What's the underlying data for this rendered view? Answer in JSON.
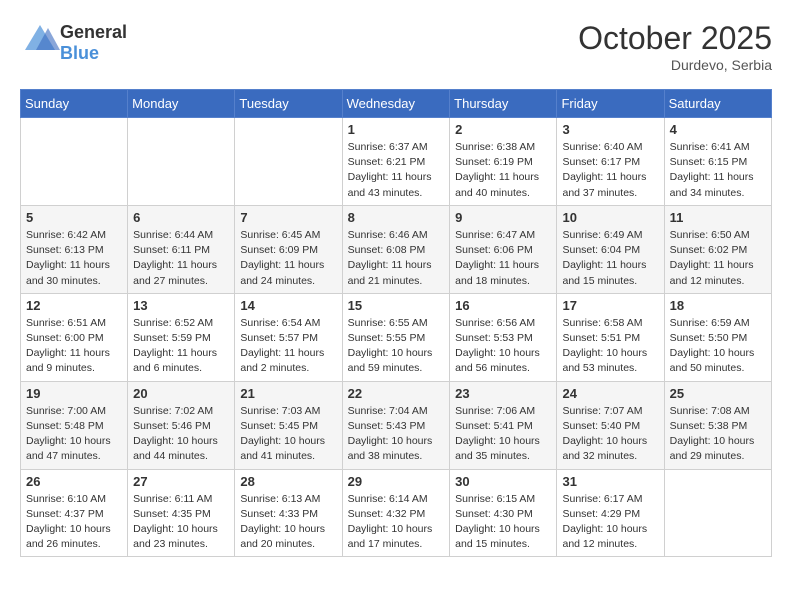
{
  "header": {
    "logo_general": "General",
    "logo_blue": "Blue",
    "month": "October 2025",
    "location": "Durdevo, Serbia"
  },
  "weekdays": [
    "Sunday",
    "Monday",
    "Tuesday",
    "Wednesday",
    "Thursday",
    "Friday",
    "Saturday"
  ],
  "weeks": [
    [
      {
        "day": "",
        "info": ""
      },
      {
        "day": "",
        "info": ""
      },
      {
        "day": "",
        "info": ""
      },
      {
        "day": "1",
        "info": "Sunrise: 6:37 AM\nSunset: 6:21 PM\nDaylight: 11 hours\nand 43 minutes."
      },
      {
        "day": "2",
        "info": "Sunrise: 6:38 AM\nSunset: 6:19 PM\nDaylight: 11 hours\nand 40 minutes."
      },
      {
        "day": "3",
        "info": "Sunrise: 6:40 AM\nSunset: 6:17 PM\nDaylight: 11 hours\nand 37 minutes."
      },
      {
        "day": "4",
        "info": "Sunrise: 6:41 AM\nSunset: 6:15 PM\nDaylight: 11 hours\nand 34 minutes."
      }
    ],
    [
      {
        "day": "5",
        "info": "Sunrise: 6:42 AM\nSunset: 6:13 PM\nDaylight: 11 hours\nand 30 minutes."
      },
      {
        "day": "6",
        "info": "Sunrise: 6:44 AM\nSunset: 6:11 PM\nDaylight: 11 hours\nand 27 minutes."
      },
      {
        "day": "7",
        "info": "Sunrise: 6:45 AM\nSunset: 6:09 PM\nDaylight: 11 hours\nand 24 minutes."
      },
      {
        "day": "8",
        "info": "Sunrise: 6:46 AM\nSunset: 6:08 PM\nDaylight: 11 hours\nand 21 minutes."
      },
      {
        "day": "9",
        "info": "Sunrise: 6:47 AM\nSunset: 6:06 PM\nDaylight: 11 hours\nand 18 minutes."
      },
      {
        "day": "10",
        "info": "Sunrise: 6:49 AM\nSunset: 6:04 PM\nDaylight: 11 hours\nand 15 minutes."
      },
      {
        "day": "11",
        "info": "Sunrise: 6:50 AM\nSunset: 6:02 PM\nDaylight: 11 hours\nand 12 minutes."
      }
    ],
    [
      {
        "day": "12",
        "info": "Sunrise: 6:51 AM\nSunset: 6:00 PM\nDaylight: 11 hours\nand 9 minutes."
      },
      {
        "day": "13",
        "info": "Sunrise: 6:52 AM\nSunset: 5:59 PM\nDaylight: 11 hours\nand 6 minutes."
      },
      {
        "day": "14",
        "info": "Sunrise: 6:54 AM\nSunset: 5:57 PM\nDaylight: 11 hours\nand 2 minutes."
      },
      {
        "day": "15",
        "info": "Sunrise: 6:55 AM\nSunset: 5:55 PM\nDaylight: 10 hours\nand 59 minutes."
      },
      {
        "day": "16",
        "info": "Sunrise: 6:56 AM\nSunset: 5:53 PM\nDaylight: 10 hours\nand 56 minutes."
      },
      {
        "day": "17",
        "info": "Sunrise: 6:58 AM\nSunset: 5:51 PM\nDaylight: 10 hours\nand 53 minutes."
      },
      {
        "day": "18",
        "info": "Sunrise: 6:59 AM\nSunset: 5:50 PM\nDaylight: 10 hours\nand 50 minutes."
      }
    ],
    [
      {
        "day": "19",
        "info": "Sunrise: 7:00 AM\nSunset: 5:48 PM\nDaylight: 10 hours\nand 47 minutes."
      },
      {
        "day": "20",
        "info": "Sunrise: 7:02 AM\nSunset: 5:46 PM\nDaylight: 10 hours\nand 44 minutes."
      },
      {
        "day": "21",
        "info": "Sunrise: 7:03 AM\nSunset: 5:45 PM\nDaylight: 10 hours\nand 41 minutes."
      },
      {
        "day": "22",
        "info": "Sunrise: 7:04 AM\nSunset: 5:43 PM\nDaylight: 10 hours\nand 38 minutes."
      },
      {
        "day": "23",
        "info": "Sunrise: 7:06 AM\nSunset: 5:41 PM\nDaylight: 10 hours\nand 35 minutes."
      },
      {
        "day": "24",
        "info": "Sunrise: 7:07 AM\nSunset: 5:40 PM\nDaylight: 10 hours\nand 32 minutes."
      },
      {
        "day": "25",
        "info": "Sunrise: 7:08 AM\nSunset: 5:38 PM\nDaylight: 10 hours\nand 29 minutes."
      }
    ],
    [
      {
        "day": "26",
        "info": "Sunrise: 6:10 AM\nSunset: 4:37 PM\nDaylight: 10 hours\nand 26 minutes."
      },
      {
        "day": "27",
        "info": "Sunrise: 6:11 AM\nSunset: 4:35 PM\nDaylight: 10 hours\nand 23 minutes."
      },
      {
        "day": "28",
        "info": "Sunrise: 6:13 AM\nSunset: 4:33 PM\nDaylight: 10 hours\nand 20 minutes."
      },
      {
        "day": "29",
        "info": "Sunrise: 6:14 AM\nSunset: 4:32 PM\nDaylight: 10 hours\nand 17 minutes."
      },
      {
        "day": "30",
        "info": "Sunrise: 6:15 AM\nSunset: 4:30 PM\nDaylight: 10 hours\nand 15 minutes."
      },
      {
        "day": "31",
        "info": "Sunrise: 6:17 AM\nSunset: 4:29 PM\nDaylight: 10 hours\nand 12 minutes."
      },
      {
        "day": "",
        "info": ""
      }
    ]
  ]
}
